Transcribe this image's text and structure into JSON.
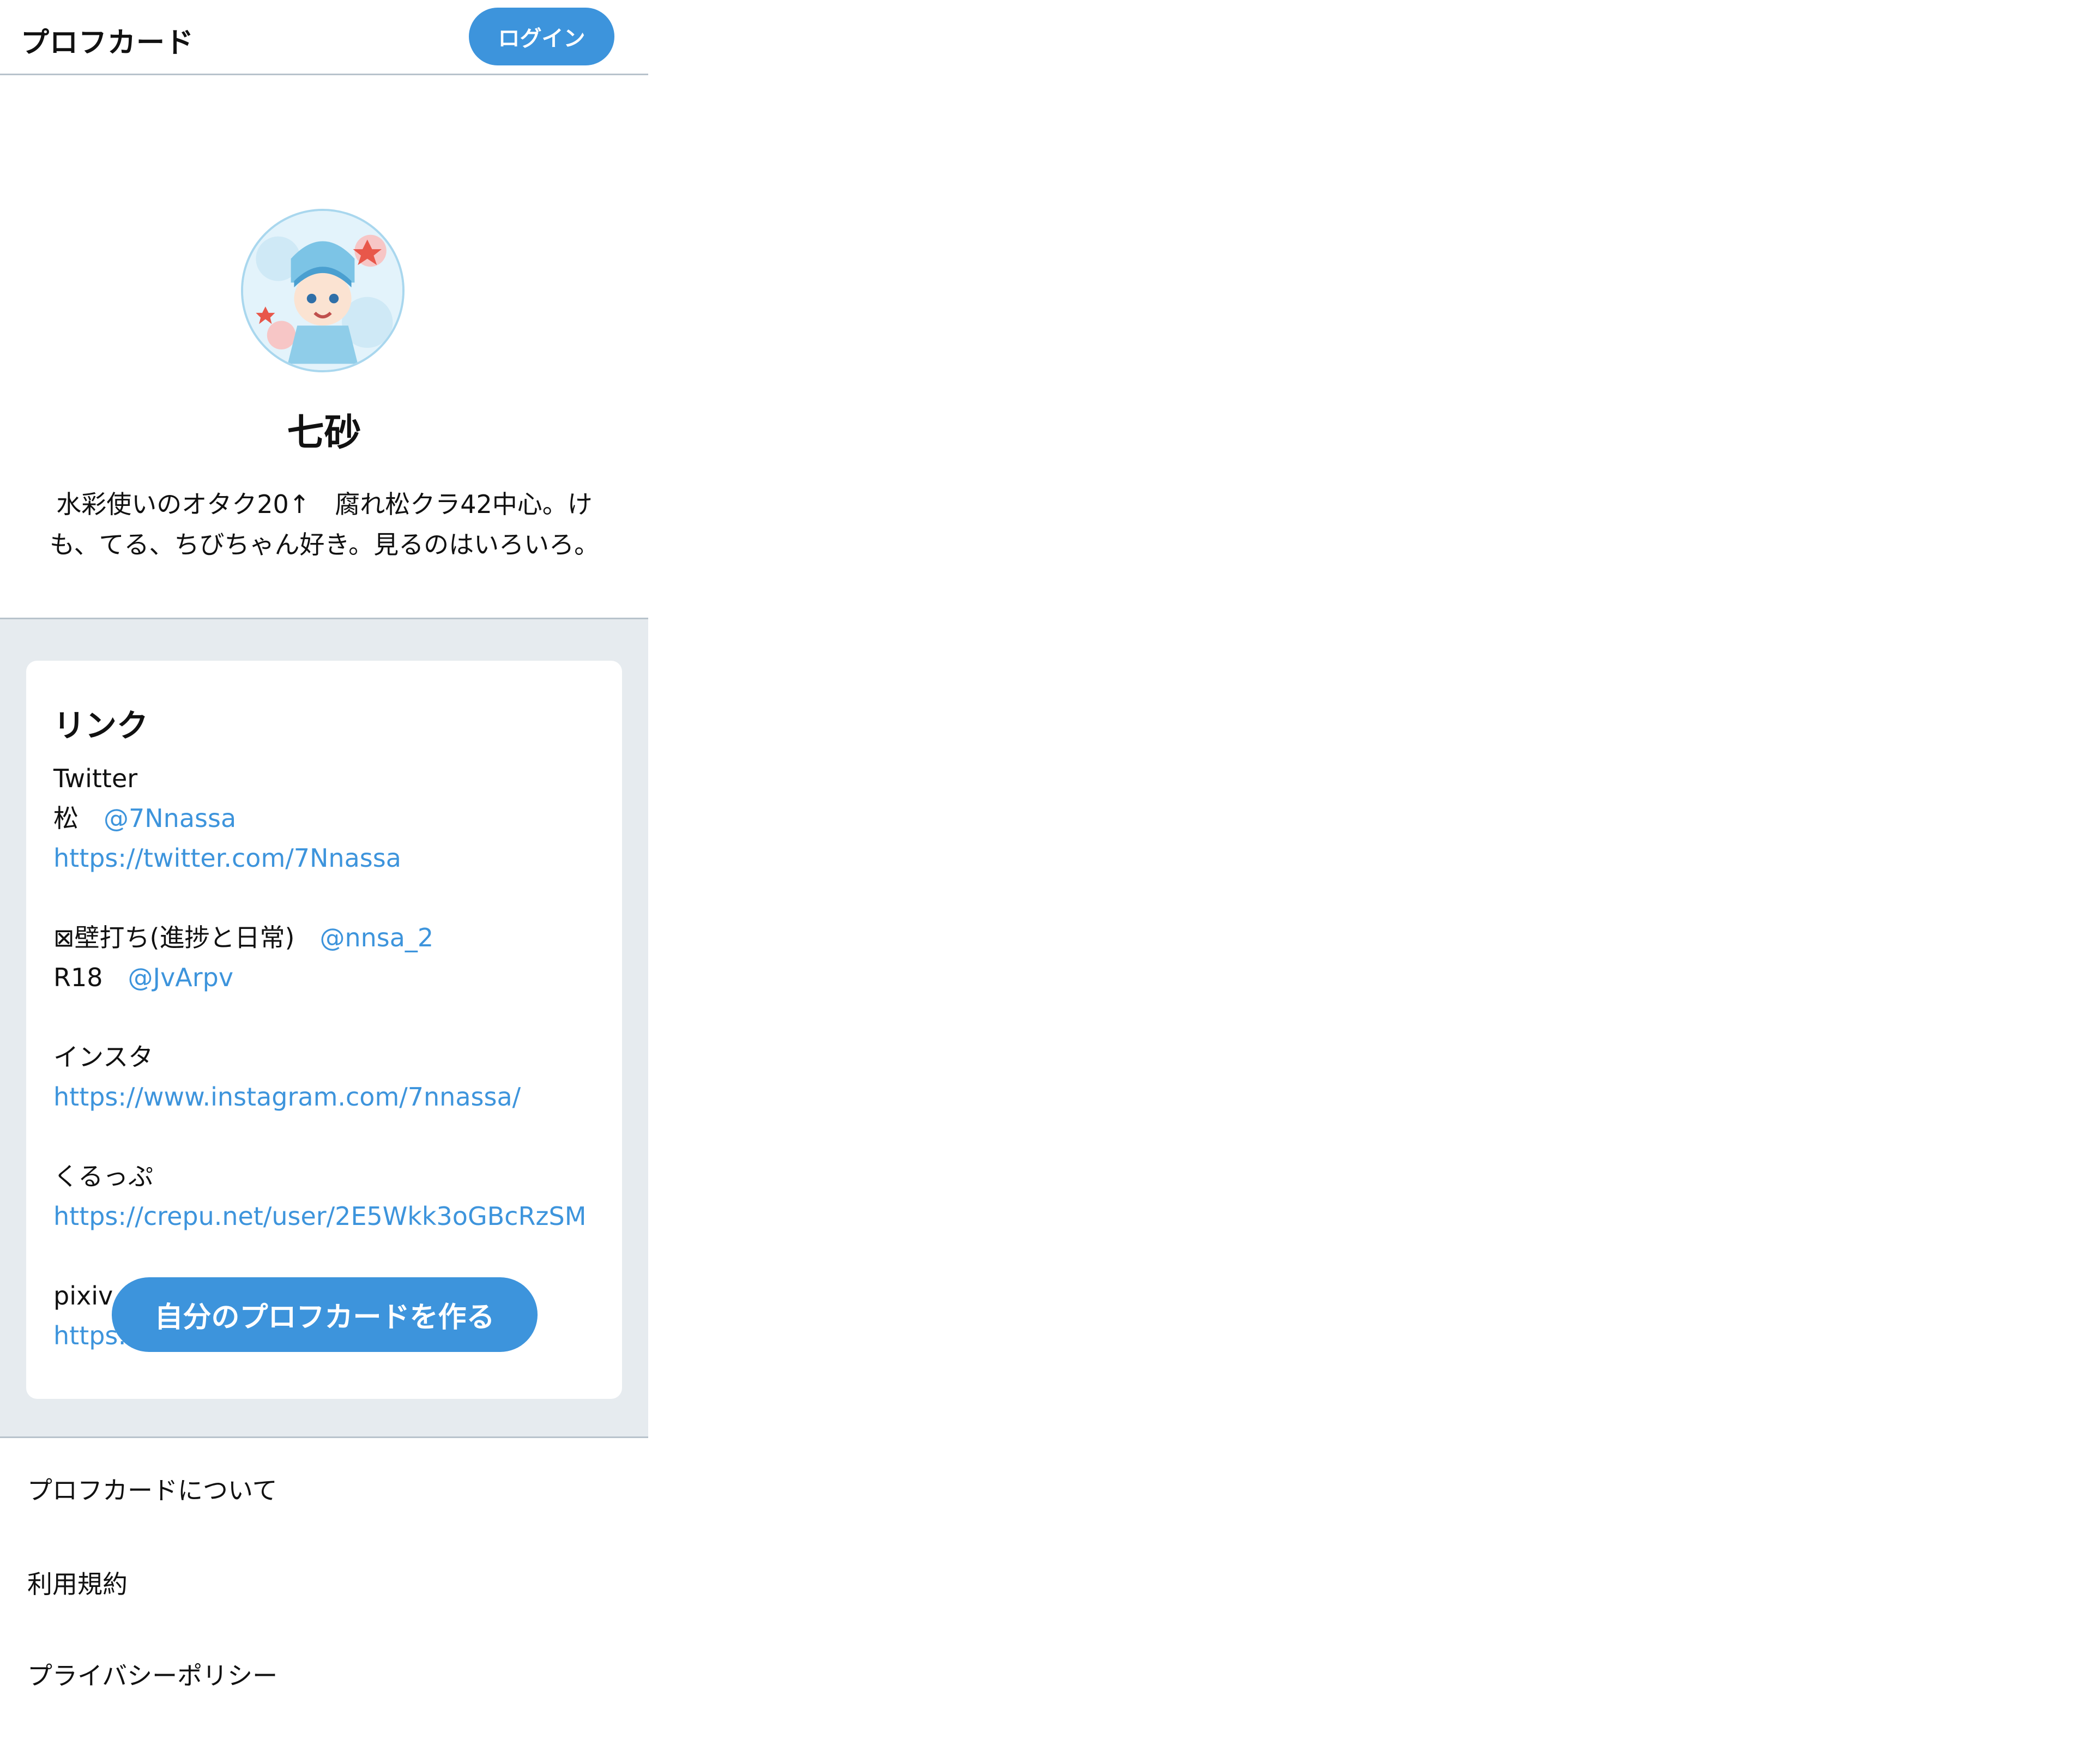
{
  "header": {
    "title": "プロフカード",
    "login_label": "ログイン"
  },
  "profile": {
    "name": "七砂",
    "bio_line1": "水彩使いのオタク20↑　腐れ松クラ42中心。け",
    "bio_line2": "も、てる、ちびちゃん好き。見るのはいろいろ。"
  },
  "links": {
    "heading": "リンク",
    "twitter_label": "Twitter",
    "matsu_label": "松",
    "matsu_handle": "@7Nnassa",
    "twitter_url": "https://twitter.com/7Nnassa",
    "kabe_label": "⊠壁打ち(進捗と日常)",
    "kabe_handle": "@nnsa_2",
    "r18_label": "R18",
    "r18_handle": "@JvArpv",
    "insta_label": "インスタ",
    "insta_url": "https://www.instagram.com/7nnassa/",
    "crepu_label": "くるっぷ",
    "crepu_url": "https://crepu.net/user/2E5Wkk3oGBcRzSM",
    "pixiv_label": "pixiv",
    "pixiv_url_visible": "https:"
  },
  "make_card_label": "自分のプロフカードを作る",
  "footer": {
    "about": "プロフカードについて",
    "terms": "利用規約",
    "privacy": "プライバシーポリシー"
  },
  "colors": {
    "accent": "#3d94dc",
    "section_bg": "#e6ebef",
    "divider": "#b8c3cc"
  }
}
